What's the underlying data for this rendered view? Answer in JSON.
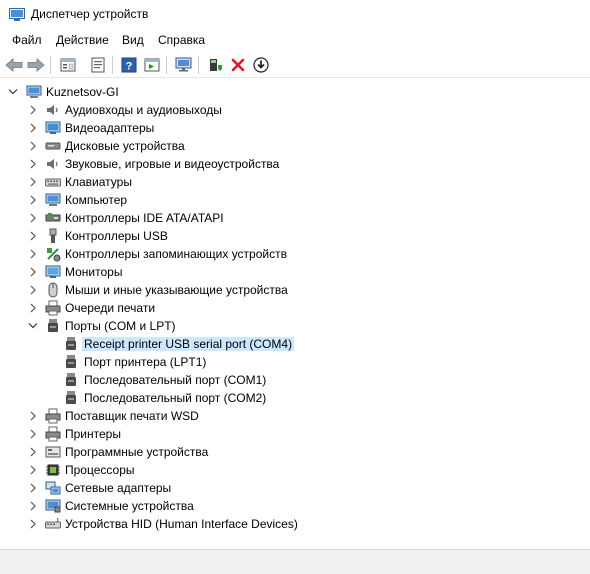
{
  "window": {
    "title": "Диспетчер устройств"
  },
  "menu": [
    "Файл",
    "Действие",
    "Вид",
    "Справка"
  ],
  "toolbar": {
    "buttons": [
      "back-icon",
      "forward-icon",
      "properties-view-icon",
      "properties-icon",
      "help-icon",
      "action-view-icon",
      "monitor-scan-icon",
      "update-driver-icon",
      "uninstall-icon",
      "download-icon"
    ]
  },
  "tree": {
    "root": "Kuznetsov-GI",
    "categories": [
      "Аудиовходы и аудиовыходы",
      "Видеоадаптеры",
      "Дисковые устройства",
      "Звуковые, игровые и видеоустройства",
      "Клавиатуры",
      "Компьютер",
      "Контроллеры IDE ATA/ATAPI",
      "Контроллеры USB",
      "Контроллеры запоминающих устройств",
      "Мониторы",
      "Мыши и иные указывающие устройства",
      "Очереди печати",
      "Порты (COM и LPT)",
      "Поставщик печати WSD",
      "Принтеры",
      "Программные устройства",
      "Процессоры",
      "Сетевые адаптеры",
      "Системные устройства",
      "Устройства HID (Human Interface Devices)"
    ],
    "ports_children": [
      "Receipt printer USB serial port (COM4)",
      "Порт принтера (LPT1)",
      "Последовательный порт (COM1)",
      "Последовательный порт (COM2)"
    ],
    "selected": "Receipt printer USB serial port (COM4)"
  },
  "colors": {
    "selection": "#cce8ff",
    "accent": "#0078d7",
    "delete": "#e81123"
  }
}
